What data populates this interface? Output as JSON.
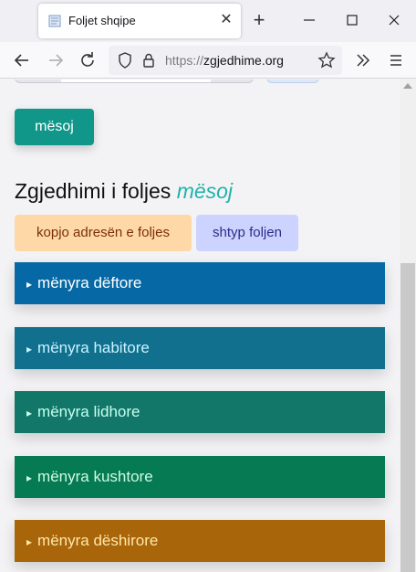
{
  "browser": {
    "tab_title": "Foljet shqipe",
    "url_protocol": "https://",
    "url_domain": "zgjedhime.org"
  },
  "page": {
    "verb_button": "mësoj",
    "heading_prefix": "Zgjedhimi i foljes",
    "heading_verb": "mësoj",
    "copy_button": "kopjo adresën e foljes",
    "print_button": "shtyp foljen",
    "moods": [
      {
        "label": "mënyra dëftore",
        "bg": "#0669a5",
        "fg": "#ffffff"
      },
      {
        "label": "mënyra habitore",
        "bg": "#10708e",
        "fg": "#c9f4ff"
      },
      {
        "label": "mënyra lidhore",
        "bg": "#127769",
        "fg": "#c6fff0"
      },
      {
        "label": "mënyra kushtore",
        "bg": "#067a53",
        "fg": "#cdfbe2"
      },
      {
        "label": "mënyra dëshirore",
        "bg": "#a8650a",
        "fg": "#ffe7a8"
      }
    ],
    "mood_arrow": "▸"
  }
}
